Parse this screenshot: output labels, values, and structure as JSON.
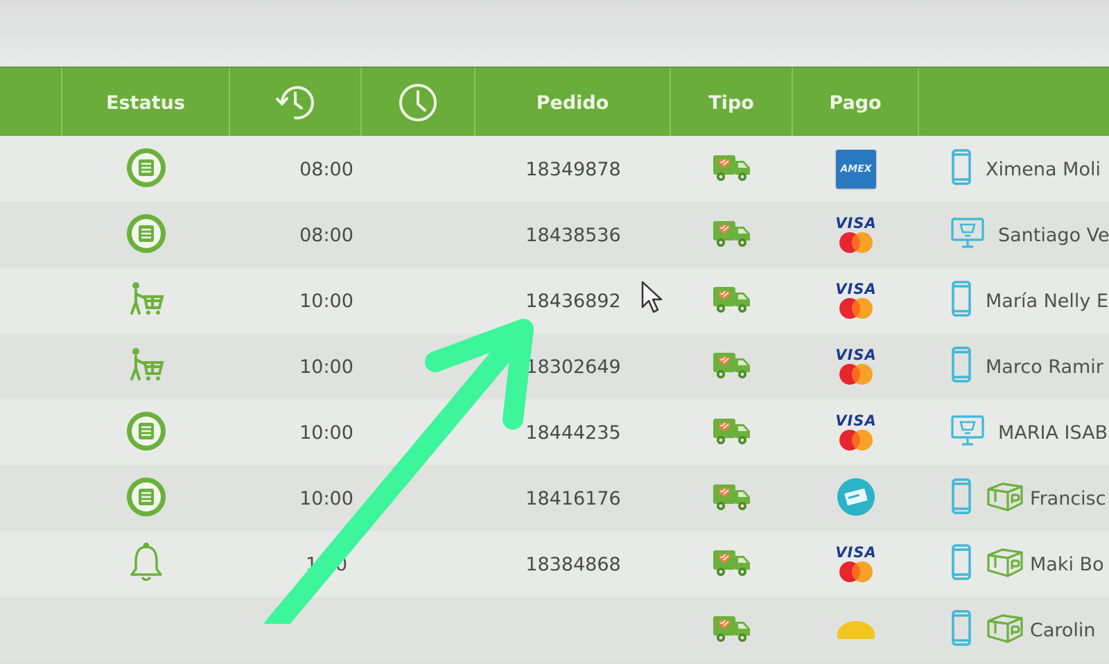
{
  "colors": {
    "header_green": "#6aad3a",
    "icon_green": "#6cb13c",
    "device_blue": "#3fb8d8",
    "annotation_arrow": "#3df59a",
    "visa_blue": "#1b3b8f",
    "amex_blue": "#2a78c0"
  },
  "table": {
    "headers": {
      "status": "Estatus",
      "promised_icon": "clock-history-icon",
      "time_icon": "clock-icon",
      "order": "Pedido",
      "type": "Tipo",
      "payment": "Pago"
    },
    "rows": [
      {
        "status_icon": "order-list-icon",
        "time": "08:00",
        "order": "18349878",
        "type_icon": "delivery-truck-icon",
        "payment_icon": "amex-card-icon",
        "payment_text": "AMEX",
        "device_icon": "phone-icon",
        "client": "Ximena Moli"
      },
      {
        "status_icon": "order-list-icon",
        "time": "08:00",
        "order": "18438536",
        "type_icon": "delivery-truck-icon",
        "payment_icon": "visa-mastercard-icon",
        "payment_text": "VISA",
        "device_icon": "desktop-icon",
        "client": "Santiago Ver"
      },
      {
        "status_icon": "shopper-cart-icon",
        "time": "10:00",
        "order": "18436892",
        "type_icon": "delivery-truck-icon",
        "payment_icon": "visa-mastercard-icon",
        "payment_text": "VISA",
        "device_icon": "phone-icon",
        "client": "María Nelly E"
      },
      {
        "status_icon": "shopper-cart-icon",
        "time": "10:00",
        "order": "18302649",
        "type_icon": "delivery-truck-icon",
        "payment_icon": "visa-mastercard-icon",
        "payment_text": "VISA",
        "device_icon": "phone-icon",
        "client": "Marco Ramir"
      },
      {
        "status_icon": "order-list-icon",
        "time": "10:00",
        "order": "18444235",
        "type_icon": "delivery-truck-icon",
        "payment_icon": "visa-mastercard-icon",
        "payment_text": "VISA",
        "device_icon": "desktop-icon",
        "client": "MARIA ISABE"
      },
      {
        "status_icon": "order-list-icon",
        "time": "10:00",
        "order": "18416176",
        "type_icon": "delivery-truck-icon",
        "payment_icon": "cash-payment-icon",
        "payment_text": "",
        "device_icon": "phone-icon",
        "pickup_icon": "pickup-box-icon",
        "client": "Francisc"
      },
      {
        "status_icon": "bell-icon",
        "time": "1  00",
        "order": "18384868",
        "type_icon": "delivery-truck-icon",
        "payment_icon": "visa-mastercard-icon",
        "payment_text": "VISA",
        "device_icon": "phone-icon",
        "pickup_icon": "pickup-box-icon",
        "client": "Maki Bo"
      },
      {
        "status_icon": "",
        "time": "",
        "order": "",
        "type_icon": "delivery-truck-icon",
        "payment_icon": "coin-icon",
        "payment_text": "",
        "device_icon": "phone-icon",
        "pickup_icon": "pickup-box-icon",
        "client": "Carolin"
      }
    ]
  }
}
